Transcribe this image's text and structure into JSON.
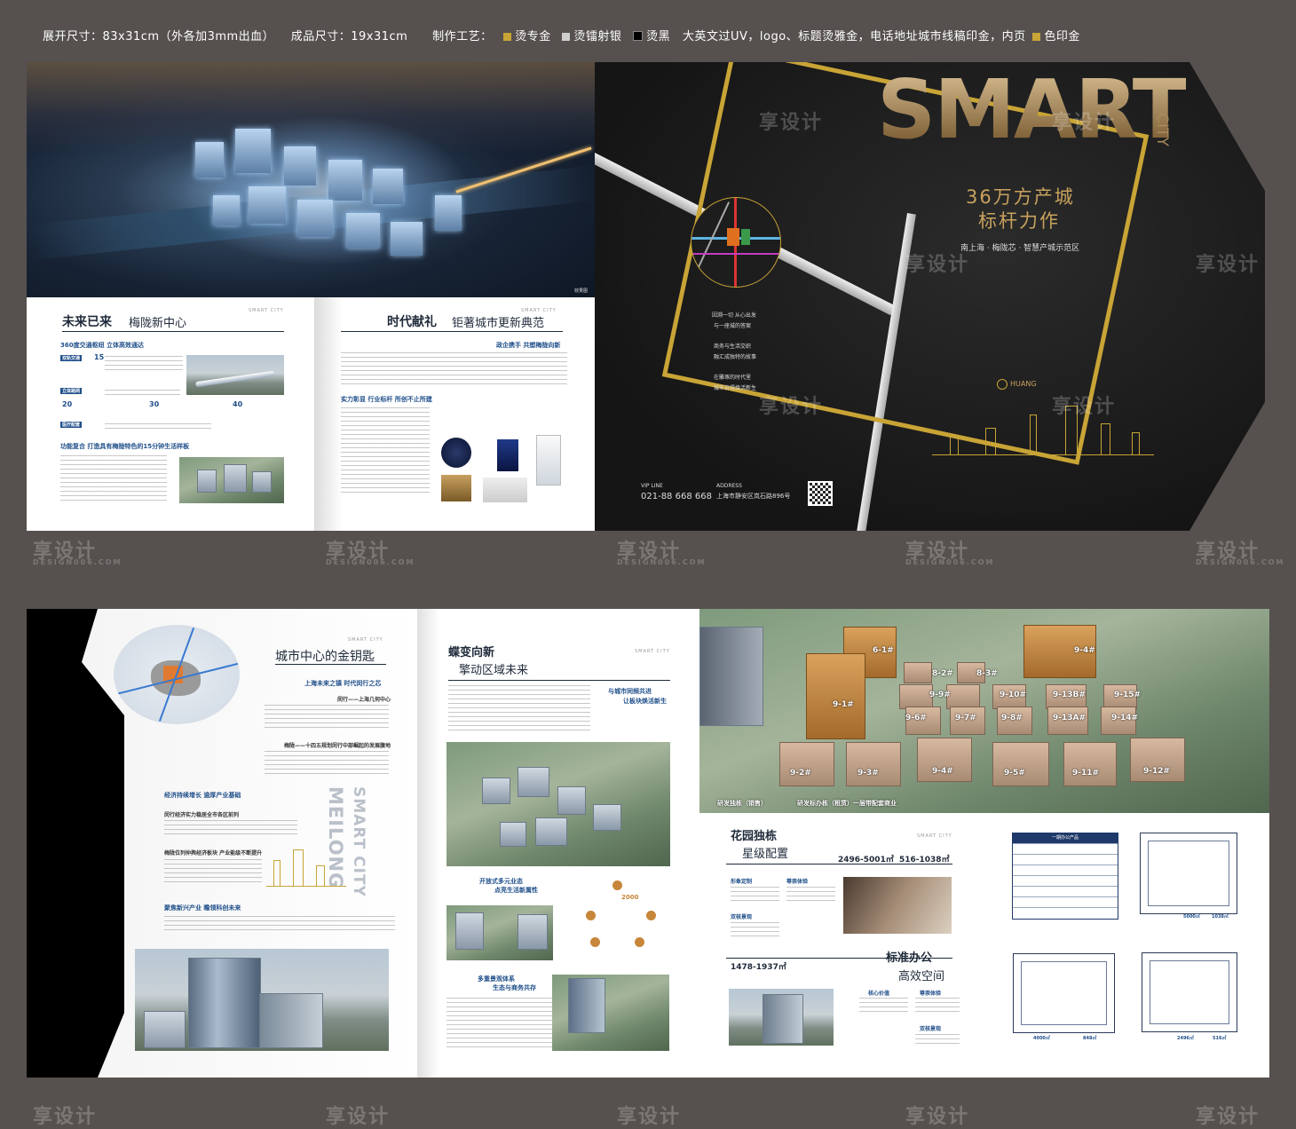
{
  "spec": {
    "unfold_label": "展开尺寸：83x31cm（外各加3mm出血）",
    "finished_label": "成品尺寸：19x31cm",
    "craft_label": "制作工艺：",
    "craft_gold": "烫专金",
    "craft_silver": "烫镭射银",
    "craft_black": "烫黑",
    "craft_rest": "大英文过UV，logo、标题烫雅金，电话地址城市线稿印金，内页",
    "craft_color": "色印金",
    "colors": {
      "gold": "#c9a436",
      "silver": "#cfcfcf",
      "black": "#000000",
      "print_gold": "#c9a436"
    }
  },
  "watermark": {
    "text": "享设计",
    "sub": "DESIGN006.COM"
  },
  "top": {
    "photo_tag": "效果图",
    "p1": {
      "title_a": "未来已来",
      "title_b": "梅陇新中心",
      "tag": "SMART CITY",
      "s1": "360度交通枢纽  立体高效通达",
      "badge1": "双轨交通",
      "badge1_val": "15",
      "badge2": "立体路网",
      "n1": "20",
      "n2": "30",
      "n3": "40",
      "badge3": "医疗配套",
      "s2": "功能复合  打造具有梅陇特色的15分钟生活样板"
    },
    "p2": {
      "title_a": "时代献礼",
      "title_b": "钜著城市更新典范",
      "tag": "SMART CITY",
      "s1": "政企携手  共塑梅陇向新",
      "s2": "实力彰显  行业标杆  所创不止所建"
    },
    "cover": {
      "big": "SMART",
      "vert": "CITY",
      "line1": "36万方产城",
      "line2": "标杆力作",
      "sub": "南上海 · 梅陇芯 · 智慧产城示范区",
      "poem": [
        "因溯一切  从心出发",
        "与一座城的答案",
        "商务与生活交织",
        "融汇成独特的故事",
        "在雕琢的时代里",
        "城市自得焕活新生"
      ],
      "logo": "HUANG",
      "vip_label": "VIP LINE",
      "vip": "021-88 668 668",
      "addr_label": "ADDRESS",
      "addr": "上海市静安区岚石路896号"
    }
  },
  "bottom": {
    "p1": {
      "title": "城市中心的金钥匙",
      "tag": "SMART CITY",
      "s1": "上海未来之镇  时代闵行之芯",
      "s1b": "闵行——上海几何中心",
      "s2": "梅陇——十四五规划闵行中部崛起的发展腹地",
      "s3": "经济持续增长  逾厚产业基础",
      "s3b": "闵行经济实力稳居全市各区前列",
      "s4": "梅陇位列仲舆经济板块  产业能级不断提升",
      "s5": "聚焦新兴产业  瞻领科创未来",
      "vert1": "MEILONG",
      "vert2": "SMART CITY"
    },
    "p2": {
      "title_a": "蝶变向新",
      "title_b": "擎动区域未来",
      "tag": "SMART CITY",
      "s1": "与城市同频共进",
      "s1b": "让板块焕活新生",
      "s2": "开放式多元业态",
      "s2b": "点亮生活新属性",
      "s3": "多重景观体系",
      "s3b": "生态与商务共存",
      "stat": "2000"
    },
    "aerial": {
      "blocks": [
        "6-1#",
        "8-2#",
        "8-3#",
        "9-4#",
        "9-1#",
        "9-9#",
        "9-10#",
        "9-13B#",
        "9-15#",
        "9-6#",
        "9-7#",
        "9-8#",
        "9-13A#",
        "9-14#",
        "9-2#",
        "9-3#",
        "9-4#",
        "9-5#",
        "9-11#",
        "9-12#"
      ],
      "legend1": "研发独栋（销售）",
      "legend2": "研发标办栋（租赁）一层带配套商业"
    },
    "p3": {
      "title_a": "花园独栋",
      "title_b": "星级配置",
      "area1": "2496-5001㎡",
      "area2": "516-1038㎡",
      "tag": "SMART CITY",
      "f1": "形象定制",
      "f2": "尊崇体验",
      "f3": "双核景观",
      "title_c": "标准办公",
      "title_d": "高效空间",
      "area3": "1478-1937㎡",
      "f4": "核心价值",
      "f5": "尊崇体验",
      "f6": "双核景观"
    },
    "plans": {
      "table_title": "一期办公产品",
      "p1": "5000㎡",
      "p2": "1038㎡",
      "p3": "4000㎡",
      "p4": "848㎡",
      "p5": "2496㎡",
      "p6": "516㎡"
    }
  }
}
